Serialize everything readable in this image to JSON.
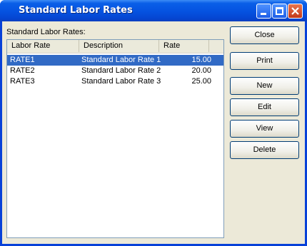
{
  "window": {
    "title": "Standard Labor Rates"
  },
  "list_label": "Standard Labor Rates:",
  "columns": [
    "Labor Rate",
    "Description",
    "Rate"
  ],
  "rows": [
    {
      "code": "RATE1",
      "description": "Standard Labor Rate 1",
      "rate": "15.00",
      "selected": true
    },
    {
      "code": "RATE2",
      "description": "Standard Labor Rate 2",
      "rate": "20.00",
      "selected": false
    },
    {
      "code": "RATE3",
      "description": "Standard Labor Rate 3",
      "rate": "25.00",
      "selected": false
    }
  ],
  "buttons": {
    "close": "Close",
    "print": "Print",
    "new": "New",
    "edit": "Edit",
    "view": "View",
    "delete": "Delete"
  },
  "colors": {
    "titlebar": "#0552e0",
    "selection": "#316ac5",
    "client": "#ece9d8"
  },
  "icons": {
    "minimize": "minimize-icon",
    "maximize": "maximize-icon",
    "close": "close-icon"
  }
}
